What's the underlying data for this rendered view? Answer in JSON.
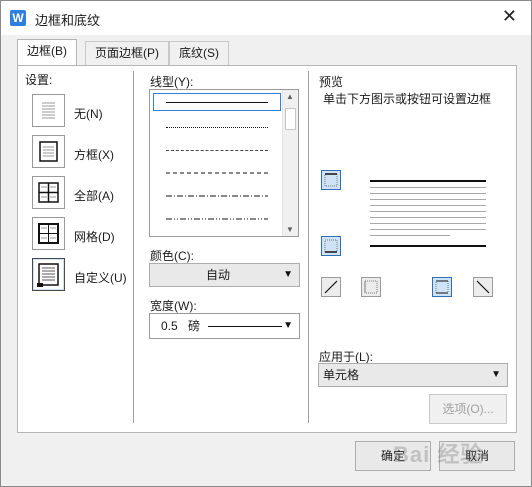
{
  "window": {
    "title": "边框和底纹",
    "app_icon_letter": "W",
    "close_glyph": "✕"
  },
  "tabs": [
    {
      "label": "边框(B)",
      "active": true
    },
    {
      "label": "页面边框(P)",
      "active": false
    },
    {
      "label": "底纹(S)",
      "active": false
    }
  ],
  "settings": {
    "heading": "设置:",
    "items": [
      {
        "label": "无(N)",
        "icon": "none-border-icon"
      },
      {
        "label": "方框(X)",
        "icon": "box-border-icon"
      },
      {
        "label": "全部(A)",
        "icon": "all-borders-icon"
      },
      {
        "label": "网格(D)",
        "icon": "grid-border-icon"
      },
      {
        "label": "自定义(U)",
        "icon": "custom-border-icon",
        "selected": true
      }
    ]
  },
  "style": {
    "linetype_label": "线型(Y):",
    "linetypes": [
      "solid",
      "dotted",
      "dashed-fine",
      "dashed",
      "dash-dot",
      "dash-dot-dot"
    ],
    "selected_linetype": "solid",
    "color_label": "颜色(C):",
    "color_value": "自动",
    "width_label": "宽度(W):",
    "width_value": "0.5",
    "width_unit": "磅"
  },
  "preview": {
    "heading": "预览",
    "hint": "单击下方图示或按钮可设置边框"
  },
  "apply": {
    "label": "应用于(L):",
    "value": "单元格",
    "options_button": "选项(O)..."
  },
  "footer": {
    "ok": "确定",
    "cancel": "取消"
  },
  "watermark_text": "Bai 经验",
  "colors": {
    "accent": "#2f7fe0",
    "toggle_on": "#cfe3f7"
  }
}
